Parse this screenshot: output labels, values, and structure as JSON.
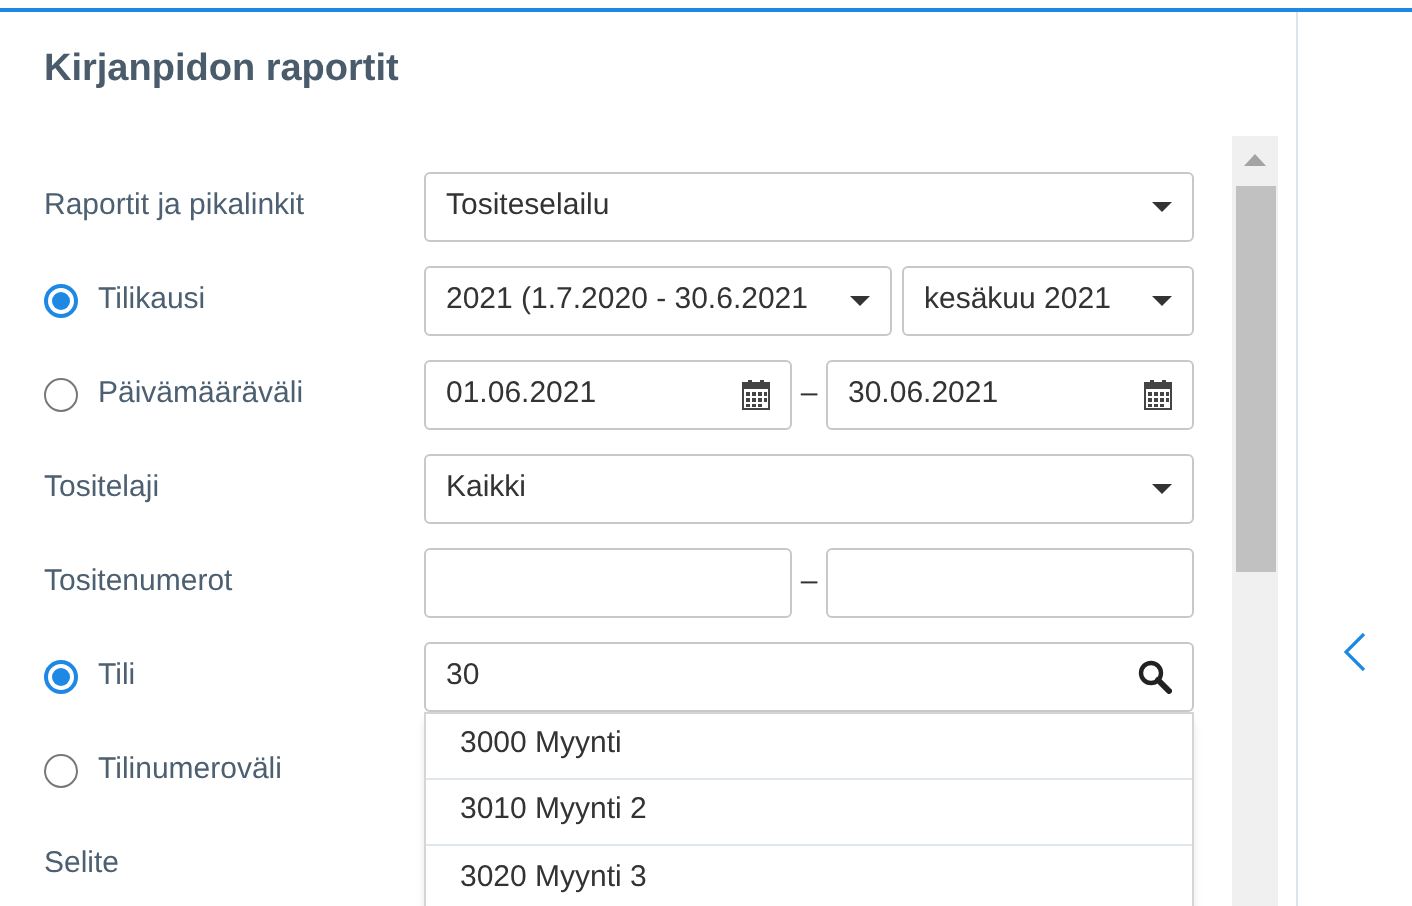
{
  "title": "Kirjanpidon raportit",
  "rows": [
    {
      "kind": "select",
      "label": "Raportit ja pikalinkit",
      "value": "Tositeselailu"
    },
    {
      "kind": "radio-selects",
      "label": "Tilikausi",
      "selected": true,
      "values": [
        "2021 (1.7.2020 - 30.6.2021",
        "kesäkuu 2021"
      ]
    },
    {
      "kind": "radio-dates",
      "label": "Päivämääräväli",
      "selected": false,
      "from": "01.06.2021",
      "separator": "–",
      "to": "30.06.2021"
    },
    {
      "kind": "select",
      "label": "Tositelaji",
      "value": "Kaikki"
    },
    {
      "kind": "range",
      "label": "Tositenumerot",
      "separator": "–"
    },
    {
      "kind": "radio-search",
      "label": "Tili",
      "selected": true,
      "value": "30",
      "suggestions": [
        "3000 Myynti",
        "3010 Myynti 2",
        "3020 Myynti 3"
      ]
    },
    {
      "kind": "radio-label",
      "label": "Tilinumeroväli",
      "selected": false
    },
    {
      "kind": "label",
      "label": "Selite"
    }
  ]
}
